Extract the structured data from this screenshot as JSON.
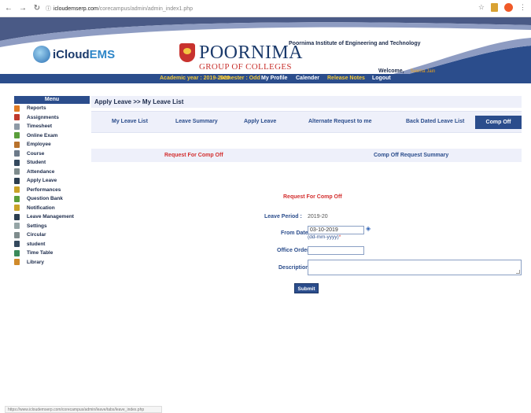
{
  "browser": {
    "url_host": "icloudemserp.com",
    "url_path": "/corecampus/admin/admin_index1.php",
    "status_url": "https://www.icloudemserp.com/corecampus/admin/leave/tabs/leave_index.php"
  },
  "header": {
    "ems_logo_primary": "iCloud",
    "ems_logo_secondary": "EMS",
    "group_logo_main": "POORNIMA",
    "group_logo_sub": "GROUP OF COLLEGES",
    "institute_name": "Poornima Institute of Engineering and Technology",
    "welcome_label": "Welcome,",
    "user_name": "Seema Jain"
  },
  "topnav": {
    "academic_year": "Academic year : 2019-2020",
    "semester": "Semester : Odd",
    "my_profile": "My Profile",
    "calender": "Calender",
    "release_notes": "Release Notes",
    "logout": "Logout"
  },
  "sidebar": {
    "title": "Menu",
    "items": [
      {
        "label": "Reports",
        "icon": "pie-chart-icon",
        "color": "#e07b24"
      },
      {
        "label": "Assignments",
        "icon": "calendar-icon",
        "color": "#c0392b"
      },
      {
        "label": "Timesheet",
        "icon": "clipboard-icon",
        "color": "#8e9aa6"
      },
      {
        "label": "Online Exam",
        "icon": "check-icon",
        "color": "#5a9e3a"
      },
      {
        "label": "Employee",
        "icon": "person-icon",
        "color": "#b8722c"
      },
      {
        "label": "Course",
        "icon": "book-icon",
        "color": "#6c7a89"
      },
      {
        "label": "Student",
        "icon": "student-icon",
        "color": "#34495e"
      },
      {
        "label": "Attendance",
        "icon": "stamp-icon",
        "color": "#7f8c8d"
      },
      {
        "label": "Apply Leave",
        "icon": "runner-icon",
        "color": "#2c3e50"
      },
      {
        "label": "Performances",
        "icon": "trophy-icon",
        "color": "#c9a227"
      },
      {
        "label": "Question Bank",
        "icon": "question-icon",
        "color": "#5a9e3a"
      },
      {
        "label": "Notification",
        "icon": "megaphone-icon",
        "color": "#c9a227"
      },
      {
        "label": "Leave Management",
        "icon": "figure-icon",
        "color": "#2c3e50"
      },
      {
        "label": "Settings",
        "icon": "gear-icon",
        "color": "#95a5a6"
      },
      {
        "label": "Circular",
        "icon": "document-icon",
        "color": "#7f8c8d"
      },
      {
        "label": "student",
        "icon": "student-icon",
        "color": "#34495e"
      },
      {
        "label": "Time Table",
        "icon": "clock-icon",
        "color": "#3a8a5a"
      },
      {
        "label": "Library",
        "icon": "books-icon",
        "color": "#d08a2a"
      }
    ]
  },
  "breadcrumb": "Apply Leave >> My Leave List",
  "tabs": [
    {
      "label": "My Leave List"
    },
    {
      "label": "Leave Summary"
    },
    {
      "label": "Apply Leave"
    },
    {
      "label": "Alternate Request to me"
    },
    {
      "label": "Back Dated Leave List"
    },
    {
      "label": "Comp Off",
      "active": true
    }
  ],
  "subtabs": {
    "request": "Request For Comp Off",
    "summary": "Comp Off Request Summary"
  },
  "form": {
    "title": "Request For Comp Off",
    "leave_period_label": "Leave Period :",
    "leave_period_value": "2019-20",
    "from_date_label": "From Date :",
    "from_date_value": "03-10-2019",
    "from_date_hint": "(dd-mm-yyyy)",
    "required_mark": "*",
    "office_order_label": "Office Order:",
    "office_order_value": "",
    "description_label": "Description:",
    "submit_label": "Submit"
  }
}
